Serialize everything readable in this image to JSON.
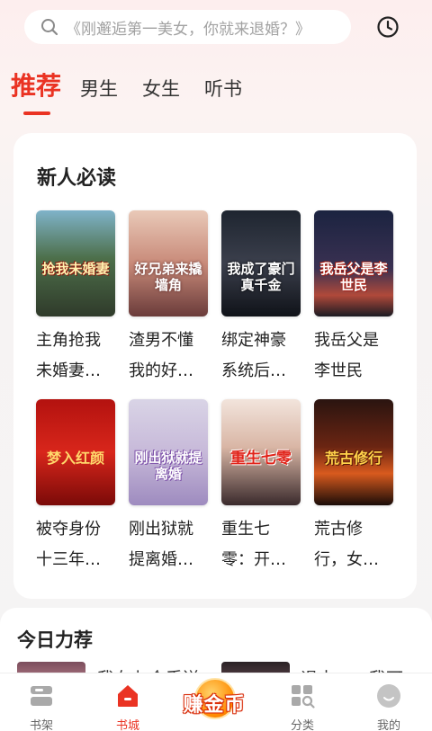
{
  "search": {
    "placeholder": "《刚邂逅第一美女，你就来退婚？》"
  },
  "tabs": [
    {
      "label": "推荐",
      "active": true
    },
    {
      "label": "男生",
      "active": false
    },
    {
      "label": "女生",
      "active": false
    },
    {
      "label": "听书",
      "active": false
    }
  ],
  "new_reader_section": {
    "title": "新人必读",
    "books": [
      {
        "line1": "主角抢我",
        "line2": "未婚妻…",
        "cover_text": "抢我未婚妻"
      },
      {
        "line1": "渣男不懂",
        "line2": "我的好…",
        "cover_text": "好兄弟来撬墙角"
      },
      {
        "line1": "绑定神豪",
        "line2": "系统后…",
        "cover_text": "我成了豪门真千金"
      },
      {
        "line1": "我岳父是",
        "line2": "李世民",
        "cover_text": "我岳父是李世民"
      },
      {
        "line1": "被夺身份",
        "line2": "十三年…",
        "cover_text": "梦入红颜"
      },
      {
        "line1": "刚出狱就",
        "line2": "提离婚…",
        "cover_text": "刚出狱就提离婚"
      },
      {
        "line1": "重生七",
        "line2": "零：开…",
        "cover_text": "重生七零"
      },
      {
        "line1": "荒古修",
        "line2": "行，女…",
        "cover_text": "荒古修行"
      }
    ]
  },
  "today_section": {
    "title": "今日力荐",
    "peek1": "我在七个丢送",
    "peek2": "退十二，我可"
  },
  "bottom_nav": {
    "shelf": "书架",
    "store": "书城",
    "earn": "赚金币",
    "category": "分类",
    "mine": "我的"
  },
  "colors": {
    "accent": "#ea3323",
    "earn_orange": "#ff8a00"
  }
}
